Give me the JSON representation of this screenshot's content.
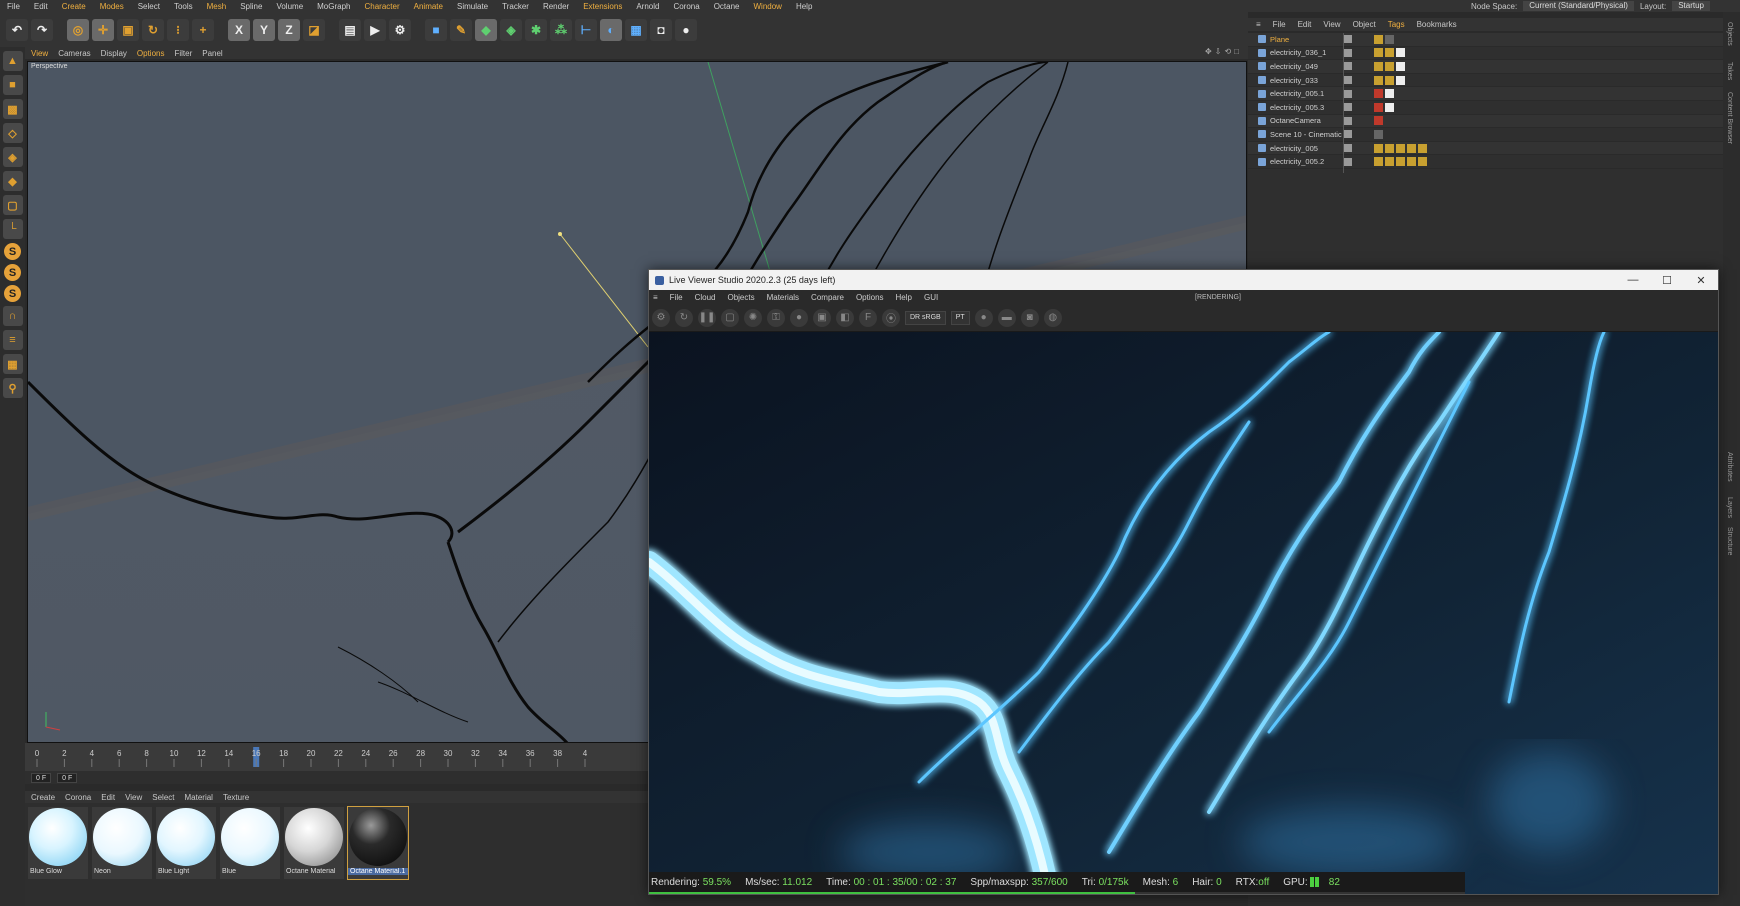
{
  "menubar": {
    "items": [
      "File",
      "Edit",
      "Create",
      "Modes",
      "Select",
      "Tools",
      "Mesh",
      "Spline",
      "Volume",
      "MoGraph",
      "Character",
      "Animate",
      "Simulate",
      "Tracker",
      "Render",
      "Extensions",
      "Arnold",
      "Corona",
      "Octane",
      "Window",
      "Help"
    ],
    "node_space_label": "Node Space:",
    "node_space_value": "Current (Standard/Physical)",
    "layout_label": "Layout:",
    "layout_value": "Startup"
  },
  "viewport": {
    "menu": [
      "View",
      "Cameras",
      "Display",
      "Options",
      "Filter",
      "Panel"
    ],
    "label": "Perspective"
  },
  "timeline": {
    "ticks": [
      "0",
      "2",
      "4",
      "6",
      "8",
      "10",
      "12",
      "14",
      "16",
      "18",
      "20",
      "22",
      "24",
      "26",
      "28",
      "30",
      "32",
      "34",
      "36",
      "38",
      "4"
    ],
    "current_frame_marker": "16",
    "start_field": "0 F",
    "end_field": "0 F"
  },
  "materials": {
    "menu": [
      "Create",
      "Corona",
      "Edit",
      "View",
      "Select",
      "Material",
      "Texture"
    ],
    "items": [
      {
        "name": "Blue Glow"
      },
      {
        "name": "Neon"
      },
      {
        "name": "Blue Light"
      },
      {
        "name": "Blue"
      },
      {
        "name": "Octane Material"
      },
      {
        "name": "Octane Material.1"
      }
    ]
  },
  "objects": {
    "menu": [
      "File",
      "Edit",
      "View",
      "Object",
      "Tags",
      "Bookmarks"
    ],
    "rows": [
      {
        "name": "Plane"
      },
      {
        "name": "electricity_036_1"
      },
      {
        "name": "electricity_049"
      },
      {
        "name": "electricity_033"
      },
      {
        "name": "electricity_005.1"
      },
      {
        "name": "electricity_005.3"
      },
      {
        "name": "OctaneCamera"
      },
      {
        "name": "Scene 10 - Cinematic"
      },
      {
        "name": "electricity_005"
      },
      {
        "name": "electricity_005.2"
      }
    ]
  },
  "side_strip": {
    "top": [
      "Objects",
      "Takes",
      "Content Browser"
    ],
    "bottom": [
      "Attributes",
      "Layers",
      "Structure"
    ]
  },
  "live_viewer": {
    "title": "Live Viewer Studio 2020.2.3 (25 days left)",
    "menu": [
      "Cloud",
      "Objects",
      "Materials",
      "Compare",
      "Options",
      "Help",
      "GUI"
    ],
    "status_tag": "[RENDERING]",
    "color_space": "DR sRGB",
    "kernel": "PT",
    "stats": {
      "rendering_label": "Rendering:",
      "rendering_value": "59.5%",
      "ms_label": "Ms/sec:",
      "ms_value": "11.012",
      "time_label": "Time:",
      "time_value": "00 : 01 : 35/00 : 02 : 37",
      "spp_label": "Spp/maxspp:",
      "spp_value": "357/600",
      "tri_label": "Tri:",
      "tri_value": "0/175k",
      "mesh_label": "Mesh:",
      "mesh_value": "6",
      "hair_label": "Hair:",
      "hair_value": "0",
      "rtx_label": "RTX:",
      "rtx_value": "off",
      "gpu_label": "GPU:",
      "gpu_value": "82"
    },
    "progress": 0.595
  }
}
